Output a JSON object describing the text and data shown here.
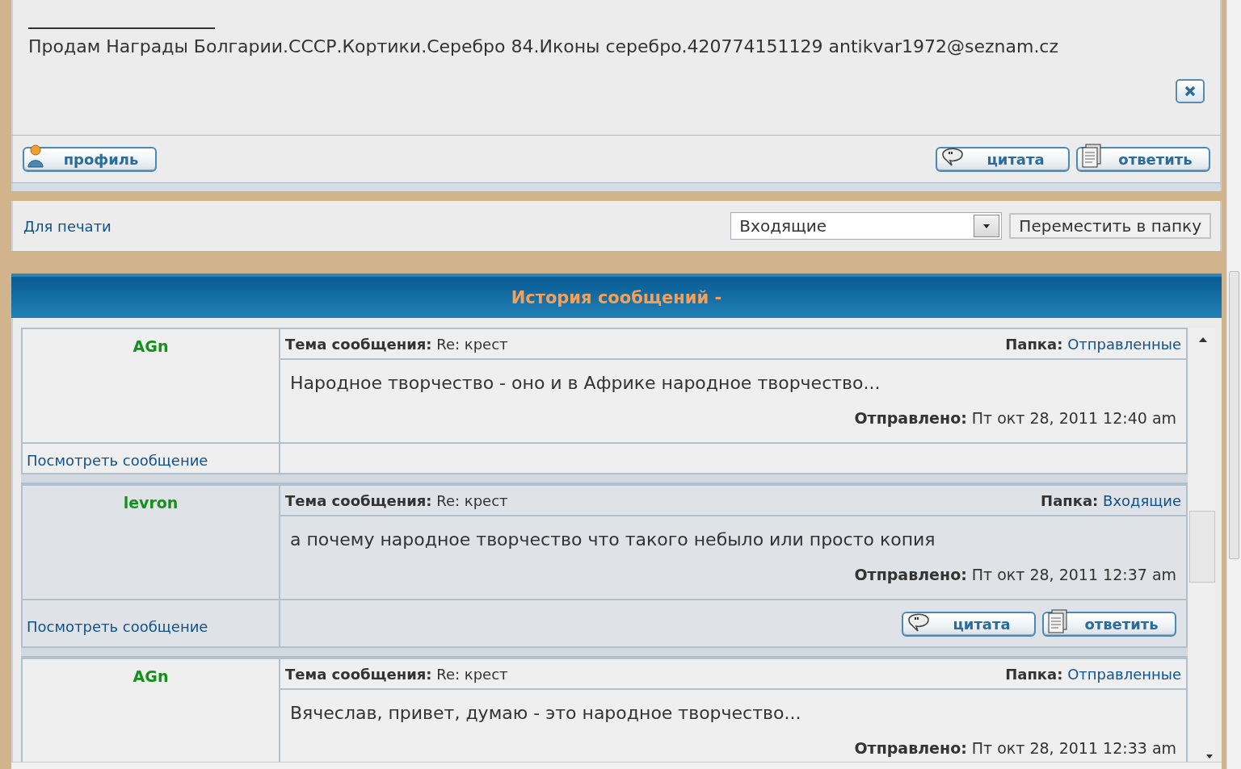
{
  "signature": {
    "text": "Продам Награды Болгарии.СССР.Кортики.Серебро 84.Иконы серебро.420774151129 antikvar1972@seznam.cz"
  },
  "post_buttons": [
    {
      "kind": "profile",
      "label": "профиль"
    },
    {
      "kind": "quote",
      "label": "цитата"
    },
    {
      "kind": "reply",
      "label": "ответить"
    }
  ],
  "toolbar": {
    "print_link": "Для печати",
    "folder_select": {
      "value": "Входящие"
    },
    "move_button": "Переместить в папку"
  },
  "history": {
    "title": "История сообщений -",
    "messages": [
      {
        "author": "AGn",
        "subject_label": "Тема сообщения:",
        "subject": "Re: крест",
        "folder_label": "Папка:",
        "folder": "Отправленные",
        "body": "Народное творчество - оно и в Африке народное творчество...",
        "sent_label": "Отправлено:",
        "sent": "Пт окт 28, 2011 12:40 am",
        "view_link": "Посмотреть сообщение"
      },
      {
        "author": "levron",
        "subject_label": "Тема сообщения:",
        "subject": "Re: крест",
        "folder_label": "Папка:",
        "folder": "Входящие",
        "body": "а почему народное творчество что такого небыло или просто копия",
        "sent_label": "Отправлено:",
        "sent": "Пт окт 28, 2011 12:37 am",
        "view_link": "Посмотреть сообщение",
        "buttons": [
          {
            "kind": "quote",
            "label": "цитата"
          },
          {
            "kind": "reply",
            "label": "ответить"
          }
        ]
      },
      {
        "author": "AGn",
        "subject_label": "Тема сообщения:",
        "subject": "Re: крест",
        "folder_label": "Папка:",
        "folder": "Отправленные",
        "body": "Вячеслав, привет, думаю - это народное творчество...",
        "sent_label": "Отправлено:",
        "sent": "Пт окт 28, 2011 12:33 am"
      }
    ]
  }
}
